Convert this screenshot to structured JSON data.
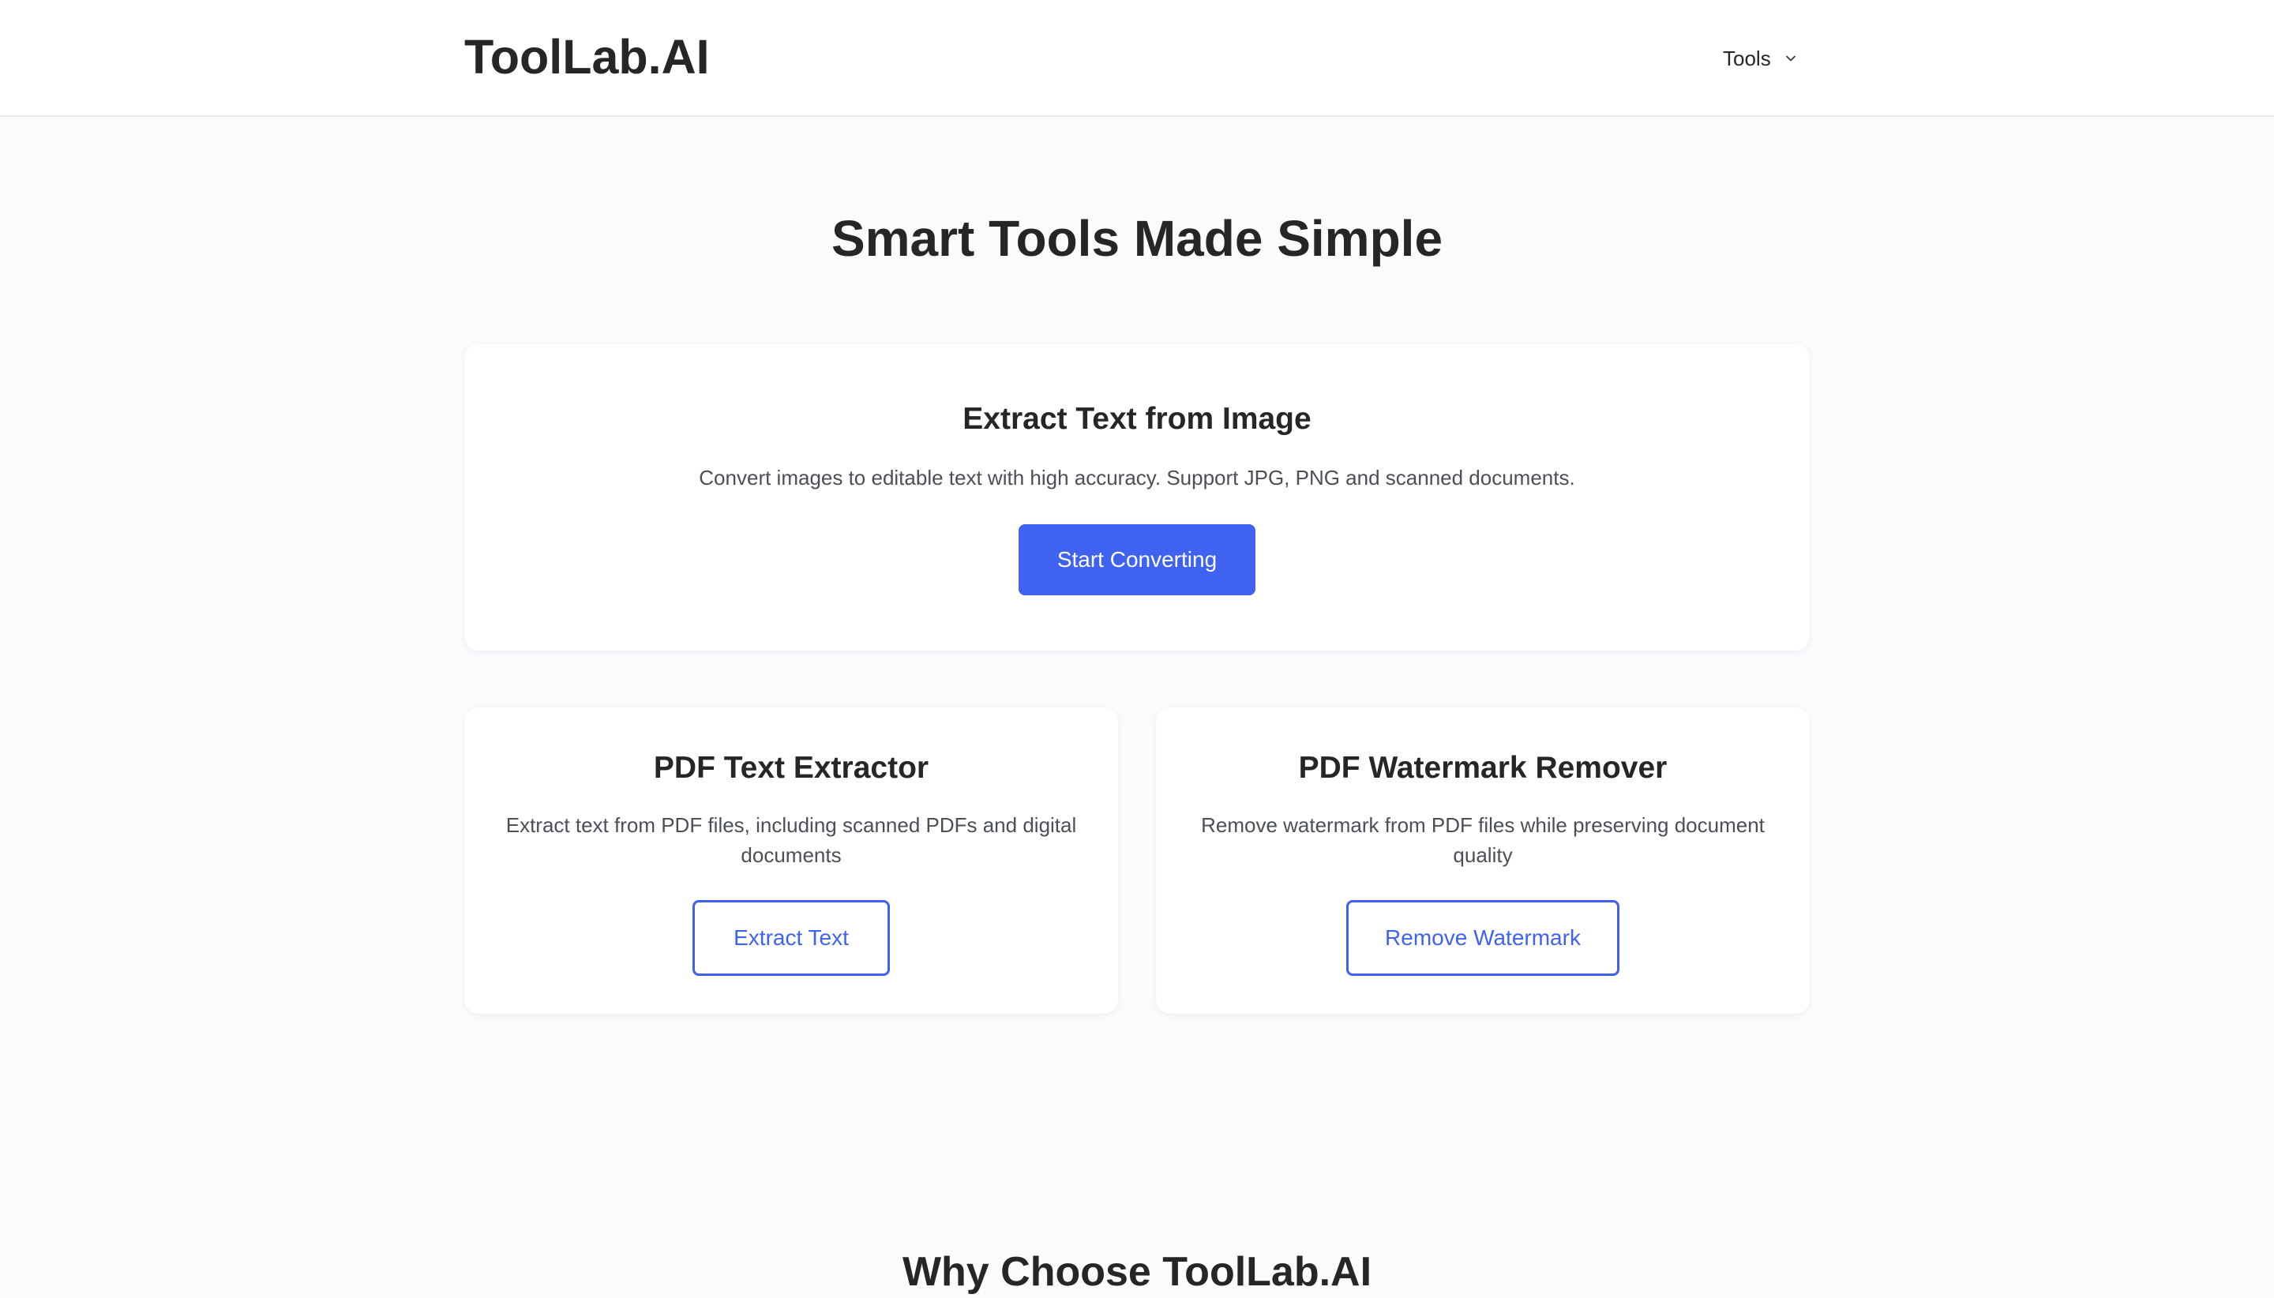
{
  "header": {
    "logo": "ToolLab.AI",
    "nav": {
      "tools_label": "Tools",
      "tools_icon": "chevron-down-icon"
    }
  },
  "hero": {
    "title": "Smart Tools Made Simple"
  },
  "cards": {
    "main": {
      "title": "Extract Text from Image",
      "description": "Convert images to editable text with high accuracy. Support JPG, PNG and scanned documents.",
      "button_label": "Start Converting"
    },
    "pdf_extractor": {
      "title": "PDF Text Extractor",
      "description_line1": "Extract text from PDF files, including scanned PDFs and digital",
      "description_line2": "documents",
      "button_label": "Extract Text"
    },
    "watermark_remover": {
      "title": "PDF Watermark Remover",
      "description_line1": "Remove watermark from PDF files while preserving document",
      "description_line2": "quality",
      "button_label": "Remove Watermark"
    }
  },
  "why_section": {
    "title": "Why Choose ToolLab.AI"
  },
  "colors": {
    "accent": "#3f63f0",
    "page_background": "#fafbfd",
    "card_background": "#ffffff",
    "heading_text": "#262626",
    "body_text": "#4b4f56"
  }
}
